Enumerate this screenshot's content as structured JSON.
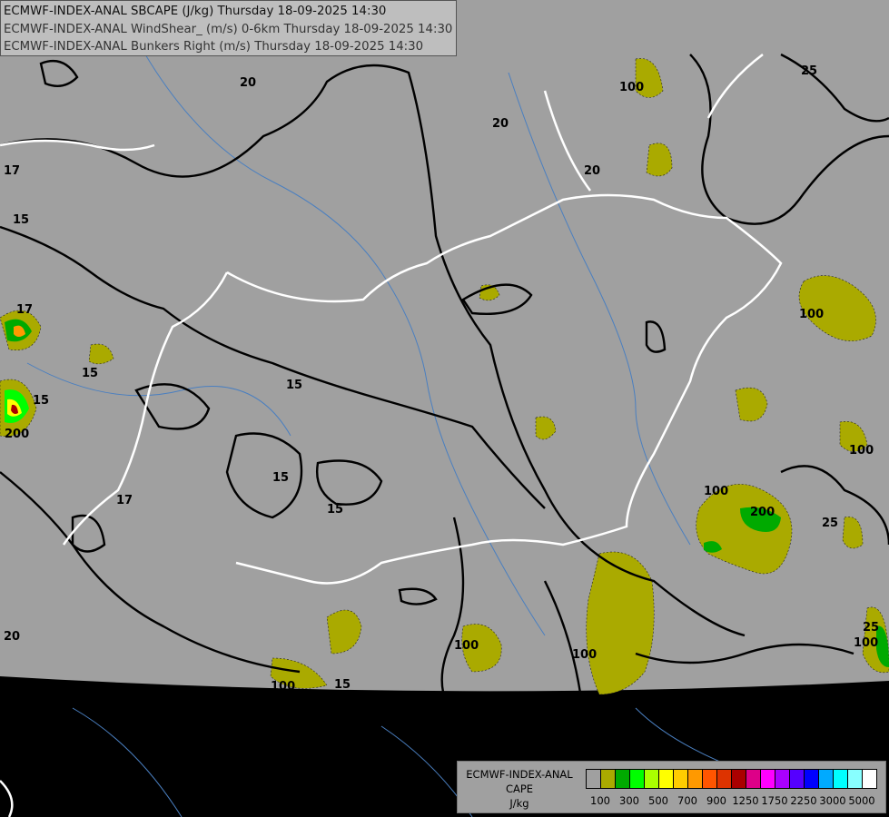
{
  "header": {
    "lines": [
      "ECMWF-INDEX-ANAL SBCAPE (J/kg) Thursday 18-09-2025 14:30",
      "ECMWF-INDEX-ANAL WindShear_ (m/s) 0-6km Thursday 18-09-2025 14:30",
      "ECMWF-INDEX-ANAL Bunkers Right (m/s) Thursday 18-09-2025 14:30"
    ]
  },
  "legend": {
    "title_lines": [
      "ECMWF-INDEX-ANAL",
      "CAPE",
      "J/kg"
    ],
    "colors": [
      "#a0a0a0",
      "#aaaa00",
      "#00aa00",
      "#00ff00",
      "#aaff00",
      "#ffff00",
      "#ffcc00",
      "#ff9900",
      "#ff5500",
      "#dd3300",
      "#aa0000",
      "#dd0088",
      "#ff00ff",
      "#aa00ff",
      "#5500ff",
      "#0000ff",
      "#00aaff",
      "#00ffff",
      "#88ffff",
      "#ffffff"
    ],
    "tick_labels": [
      "100",
      "300",
      "500",
      "700",
      "900",
      "1250",
      "1750",
      "2250",
      "3000",
      "5000"
    ]
  },
  "map": {
    "background_color": "#000000",
    "domain_color": "#a0a0a0",
    "cape_fill_color": "#aaaa00",
    "border_color": "#ffffff",
    "river_color": "#4a7fc0",
    "contour_labels": [
      "20",
      "25",
      "20",
      "20",
      "17",
      "15",
      "15",
      "15",
      "15",
      "15",
      "15",
      "17",
      "20",
      "100",
      "100",
      "100",
      "100",
      "100",
      "100",
      "200",
      "25",
      "25",
      "100",
      "100",
      "200",
      "17",
      "15"
    ]
  }
}
